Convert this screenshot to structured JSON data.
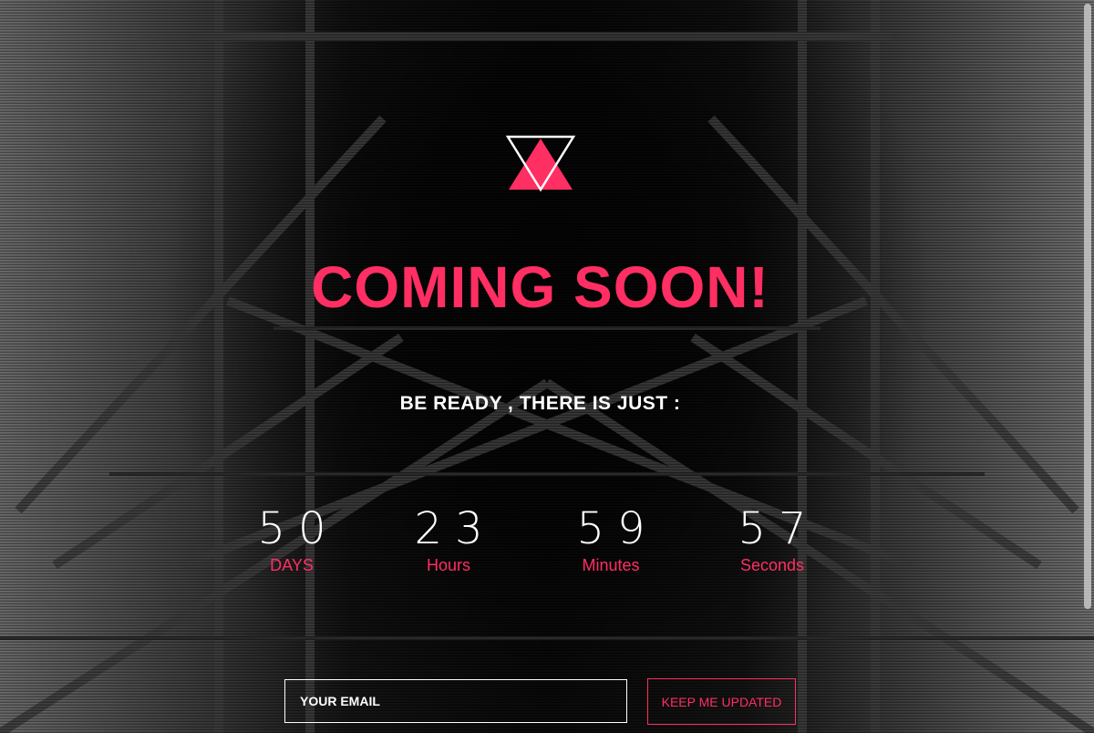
{
  "page": {
    "headline": "COMING SOON!",
    "subheadline": "BE READY , THERE IS JUST :",
    "accent_color": "#ff2e63"
  },
  "logo": {
    "icon": "triangle-logo-icon"
  },
  "countdown": {
    "days": {
      "value": "50",
      "label": "DAYS"
    },
    "hours": {
      "value": "23",
      "label": "Hours"
    },
    "minutes": {
      "value": "59",
      "label": "Minutes"
    },
    "seconds": {
      "value": "57",
      "label": "Seconds"
    }
  },
  "subscribe": {
    "email_placeholder": "YOUR EMAIL",
    "button_label": "KEEP ME UPDATED"
  }
}
